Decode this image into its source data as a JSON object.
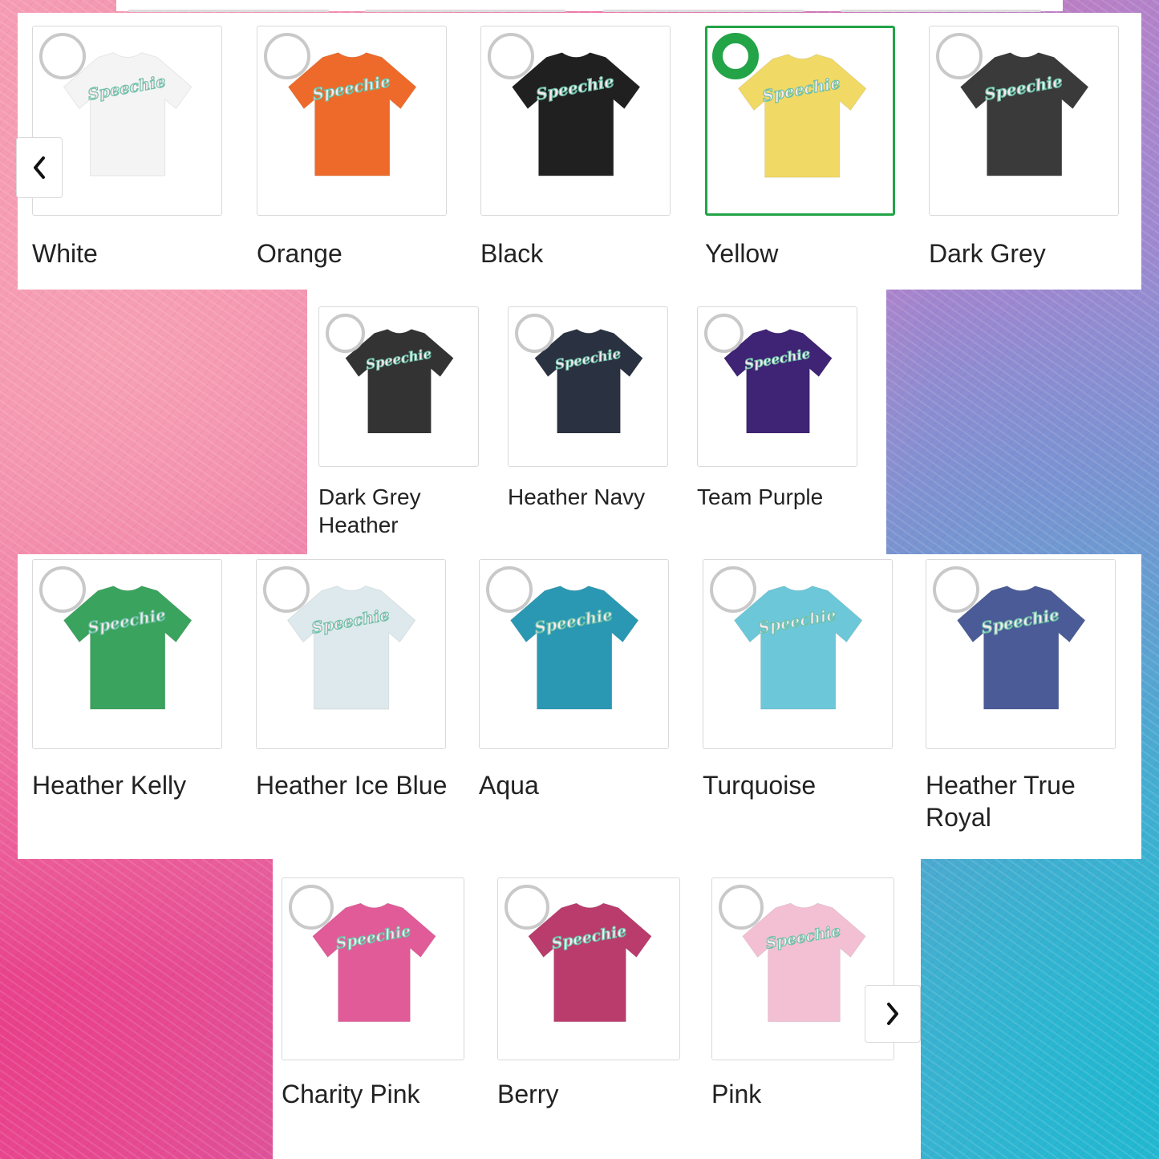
{
  "selected_color": "Yellow",
  "shirt_print": "Speechie",
  "navigation": {
    "prev_icon": "chevron-left-icon",
    "next_icon": "chevron-right-icon"
  },
  "rows": [
    {
      "swatches": [
        {
          "label": "White",
          "color": "#f4f4f4",
          "selected": false
        },
        {
          "label": "Orange",
          "color": "#ee6a2a",
          "selected": false
        },
        {
          "label": "Black",
          "color": "#202020",
          "selected": false
        },
        {
          "label": "Yellow",
          "color": "#f1d965",
          "selected": true
        },
        {
          "label": "Dark Grey",
          "color": "#3a3a3a",
          "selected": false
        }
      ]
    },
    {
      "swatches": [
        {
          "label": "Dark Grey Heather",
          "color": "#333333",
          "selected": false
        },
        {
          "label": "Heather Navy",
          "color": "#2a3140",
          "selected": false
        },
        {
          "label": "Team Purple",
          "color": "#3f2374",
          "selected": false
        }
      ]
    },
    {
      "swatches": [
        {
          "label": "Heather Kelly",
          "color": "#3aa35d",
          "selected": false
        },
        {
          "label": "Heather Ice Blue",
          "color": "#dde9ec",
          "selected": false
        },
        {
          "label": "Aqua",
          "color": "#2a98b3",
          "selected": false
        },
        {
          "label": "Turquoise",
          "color": "#6cc7d9",
          "selected": false
        },
        {
          "label": "Heather True Royal",
          "color": "#4a5b97",
          "selected": false
        }
      ]
    },
    {
      "swatches": [
        {
          "label": "Charity Pink",
          "color": "#e15b98",
          "selected": false
        },
        {
          "label": "Berry",
          "color": "#b93c6c",
          "selected": false
        },
        {
          "label": "Pink",
          "color": "#f3c0d3",
          "selected": false
        }
      ]
    }
  ]
}
